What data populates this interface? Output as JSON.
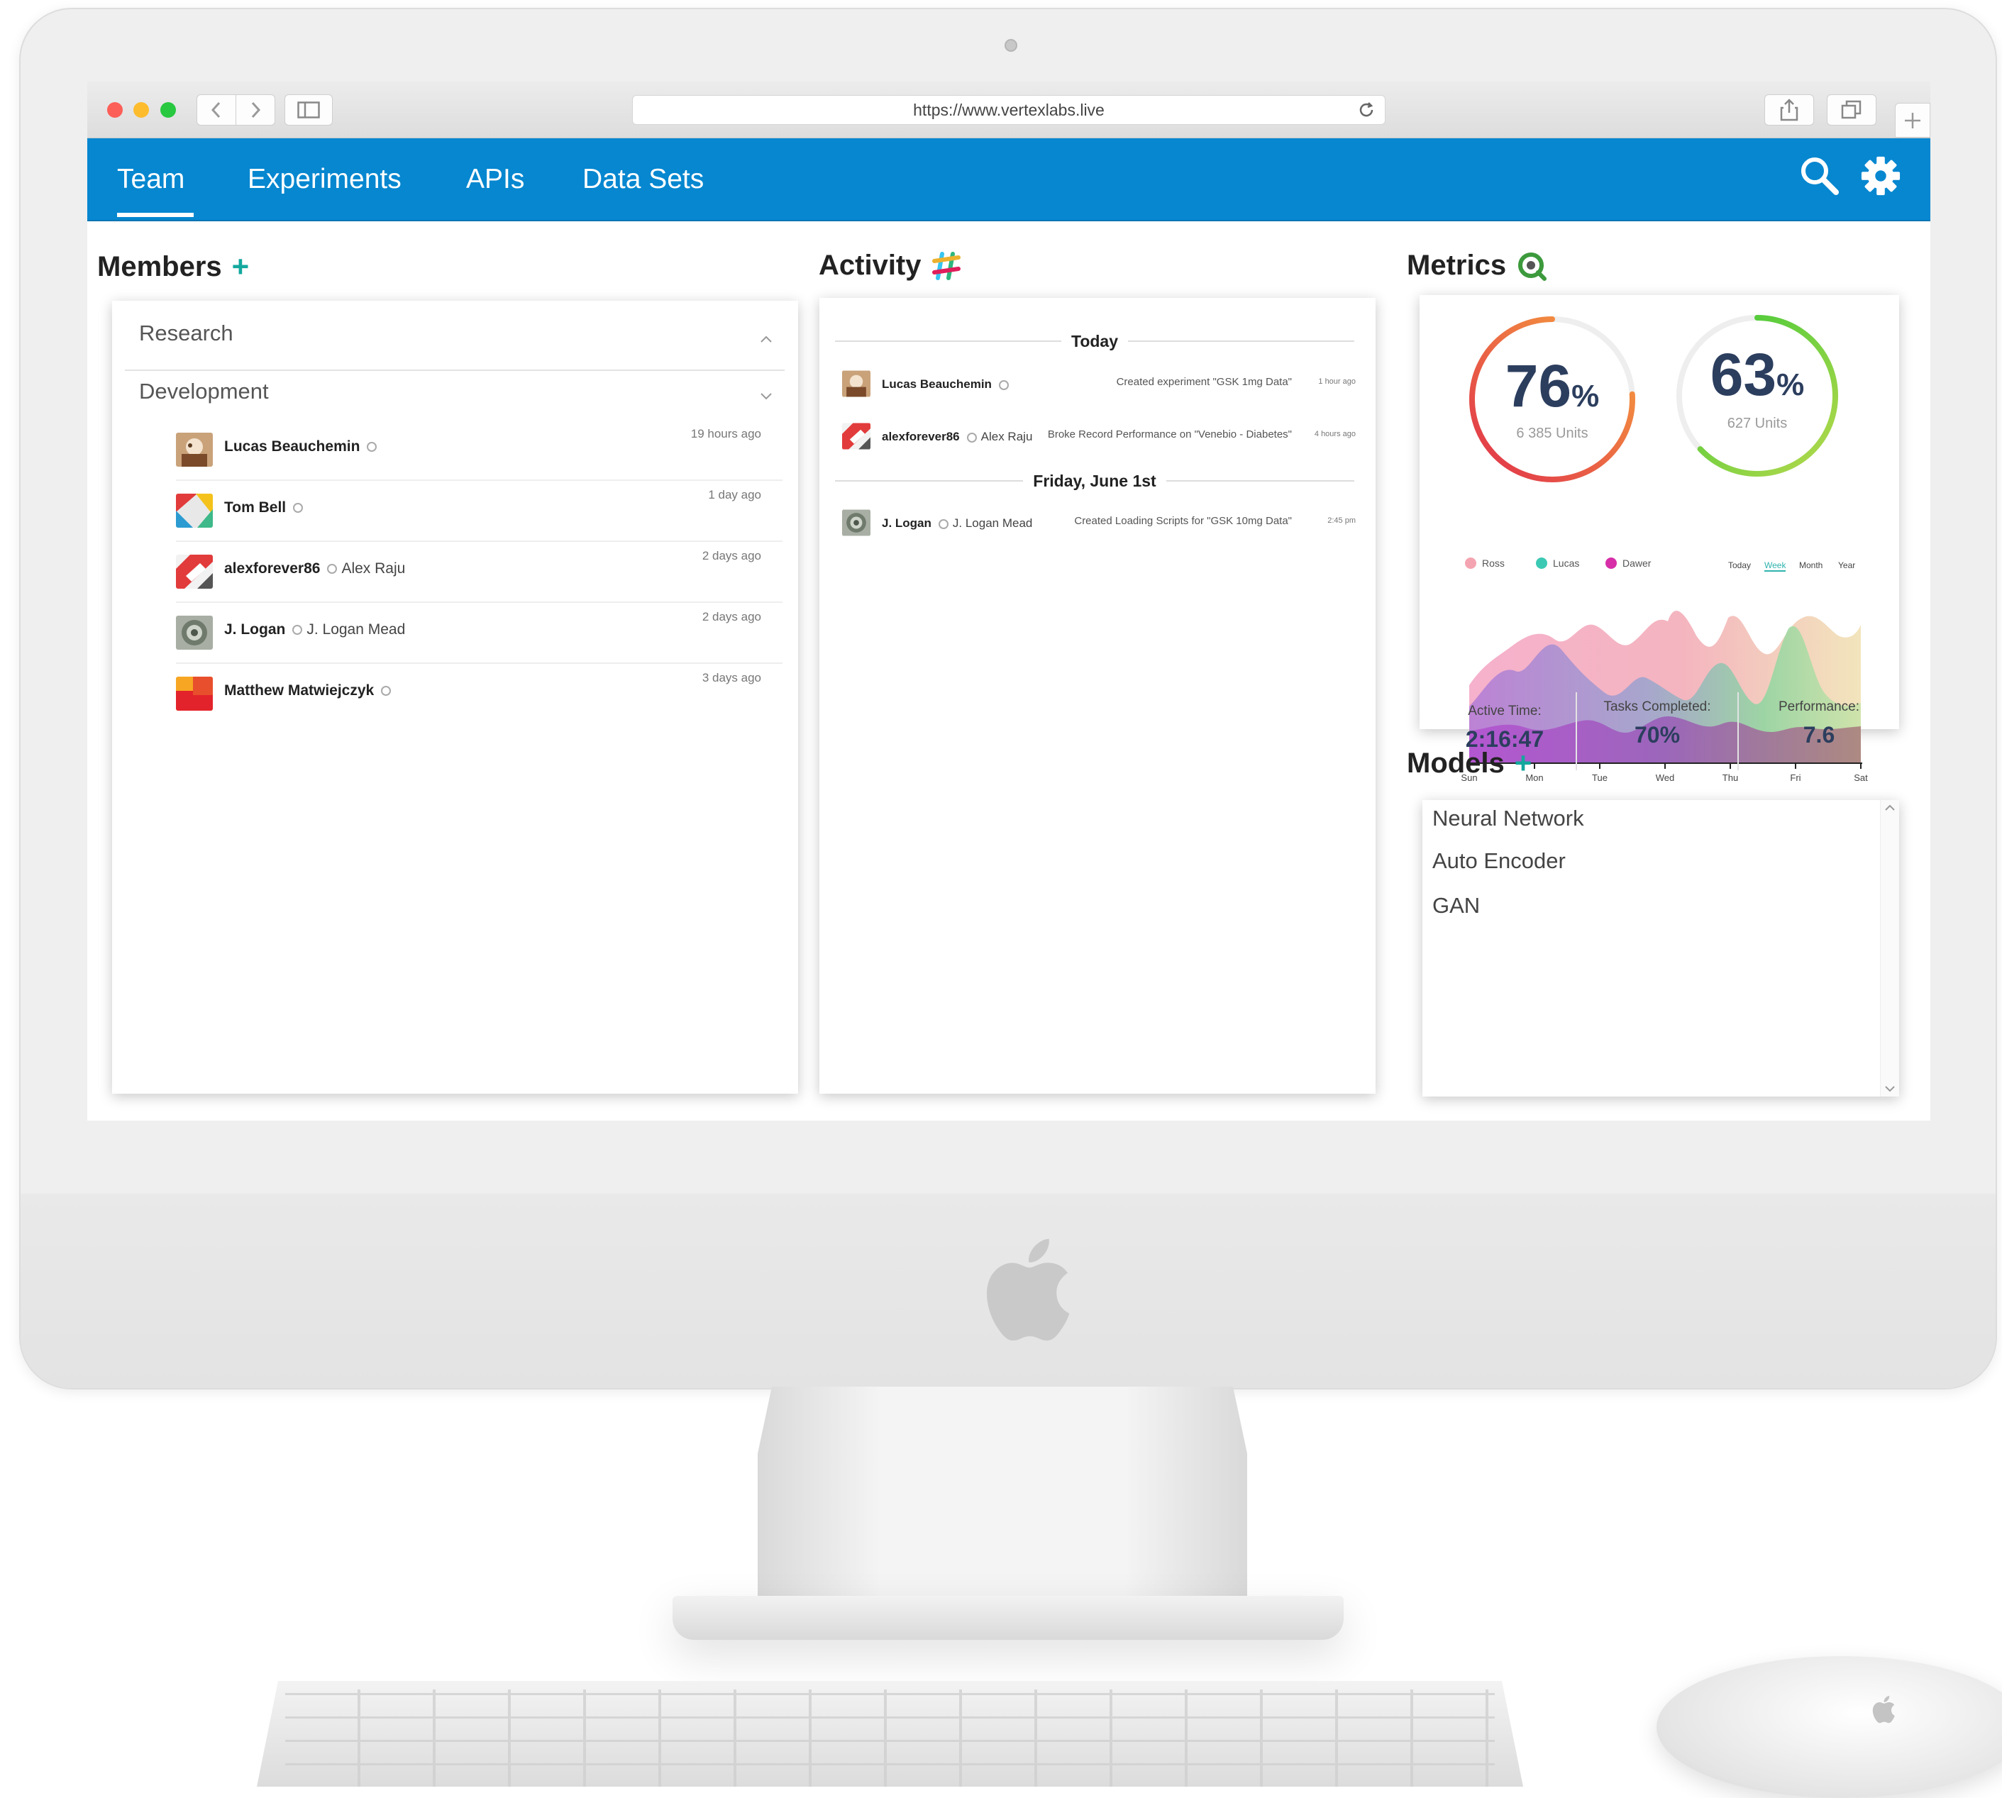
{
  "browser": {
    "url": "https://www.vertexlabs.live"
  },
  "nav": {
    "tabs": [
      {
        "label": "Team",
        "active": true
      },
      {
        "label": "Experiments",
        "active": false
      },
      {
        "label": "APIs",
        "active": false
      },
      {
        "label": "Data Sets",
        "active": false
      }
    ],
    "icons": [
      "search-icon",
      "gear-icon"
    ]
  },
  "members": {
    "title": "Members",
    "add_label": "+",
    "groups": [
      {
        "name": "Research",
        "expanded": false
      },
      {
        "name": "Development",
        "expanded": true
      }
    ],
    "rows": [
      {
        "name": "Lucas Beauchemin",
        "sub": "",
        "time": "19 hours ago"
      },
      {
        "name": "Tom Bell",
        "sub": "",
        "time": "1 day ago"
      },
      {
        "name": "alexforever86",
        "sub": "Alex Raju",
        "time": "2 days ago"
      },
      {
        "name": "J. Logan",
        "sub": "J. Logan Mead",
        "time": "2 days ago"
      },
      {
        "name": "Matthew Matwiejczyk",
        "sub": "",
        "time": "3 days ago"
      }
    ]
  },
  "activity": {
    "title": "Activity",
    "days": [
      {
        "label": "Today",
        "entries": [
          {
            "name": "Lucas Beauchemin",
            "sub": "",
            "desc": "Created experiment \"GSK 1mg Data\"",
            "time": "1 hour ago"
          },
          {
            "name": "alexforever86",
            "sub": "Alex Raju",
            "desc": "Broke Record Performance on \"Venebio - Diabetes\"",
            "time": "4 hours ago"
          }
        ]
      },
      {
        "label": "Friday, June 1st",
        "entries": [
          {
            "name": "J. Logan",
            "sub": "J. Logan Mead",
            "desc": "Created Loading Scripts for \"GSK 10mg Data\"",
            "time": "2:45 pm"
          }
        ]
      }
    ]
  },
  "metrics": {
    "title": "Metrics",
    "gauges": [
      {
        "value": "76",
        "unit": "%",
        "units_label": "6 385 Units",
        "fraction": 0.76
      },
      {
        "value": "63",
        "unit": "%",
        "units_label": "627 Units",
        "fraction": 0.63
      }
    ],
    "legend": [
      {
        "name": "Ross",
        "color": "#f4a4b0"
      },
      {
        "name": "Lucas",
        "color": "#3cc9b4"
      },
      {
        "name": "Dawer",
        "color": "#d62fa8"
      }
    ],
    "ranges": [
      {
        "label": "Today",
        "active": false
      },
      {
        "label": "Week",
        "active": true
      },
      {
        "label": "Month",
        "active": false
      },
      {
        "label": "Year",
        "active": false
      }
    ],
    "days": [
      "Sun",
      "Mon",
      "Tue",
      "Wed",
      "Thu",
      "Fri",
      "Sat"
    ],
    "stats": [
      {
        "label": "Active Time:",
        "value": "2:16:47"
      },
      {
        "label": "Tasks Completed:",
        "value": "70%"
      },
      {
        "label": "Performance:",
        "value": "7.6"
      }
    ]
  },
  "models": {
    "title": "Models",
    "add_label": "+",
    "items": [
      "Neural Network",
      "Auto Encoder",
      "GAN"
    ]
  },
  "colors": {
    "nav_blue": "#0687d0",
    "accent_teal": "#13a89e",
    "gauge_green": "#5fcf3a",
    "gauge_orange": "#f38a3c"
  }
}
